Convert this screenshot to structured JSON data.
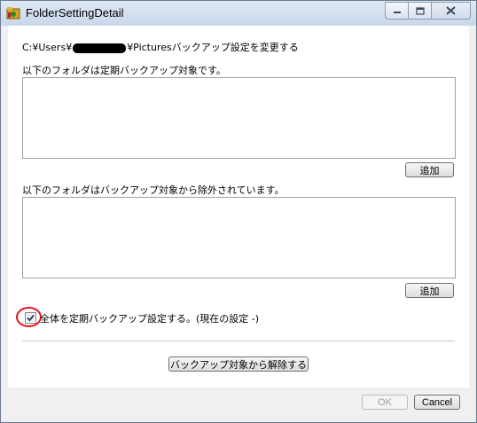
{
  "window": {
    "title": "FolderSettingDetail",
    "icon": "folder-app-icon",
    "buttons": {
      "minimize": "minimize-icon",
      "maximize": "maximize-icon",
      "close": "close-icon"
    }
  },
  "main": {
    "path_prefix": "C:¥Users¥",
    "path_suffix": "¥Picturesバックアップ設定を変更する",
    "included_label": "以下のフォルダは定期バックアップ対象です。",
    "included_items": [],
    "add_label_1": "追加",
    "excluded_label": "以下のフォルダはバックアップ対象から除外されています。",
    "excluded_items": [],
    "add_label_2": "追加",
    "checkbox_checked": true,
    "checkbox_label": "全体を定期バックアップ設定する。(現在の設定 -)",
    "remove_button": "バックアップ対象から解除する"
  },
  "footer": {
    "ok_label": "OK",
    "cancel_label": "Cancel"
  },
  "colors": {
    "highlight_ring": "#e01020",
    "titlebar": "#c9d7ea"
  }
}
